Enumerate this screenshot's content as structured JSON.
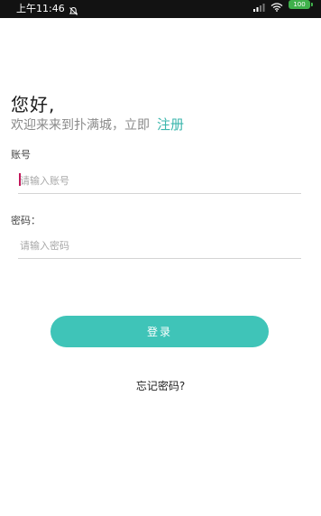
{
  "status_bar": {
    "time": "上午11:46",
    "battery": "100",
    "icons": [
      "mute-icon",
      "signal-icon",
      "wifi-icon",
      "battery-icon"
    ]
  },
  "greeting": {
    "title": "您好,",
    "subtitle": "欢迎来来到扑满城，立即",
    "register_link": "注册"
  },
  "account": {
    "label": "账号",
    "placeholder": "请输入账号",
    "value": ""
  },
  "password": {
    "label": "密码：",
    "placeholder": "请输入密码",
    "value": ""
  },
  "login_button": "登录",
  "forgot_password": "忘记密码?",
  "colors": {
    "accent": "#3fc4b8",
    "link": "#3ab6ac",
    "status_bar": "#121212",
    "caret": "#c2185b"
  }
}
